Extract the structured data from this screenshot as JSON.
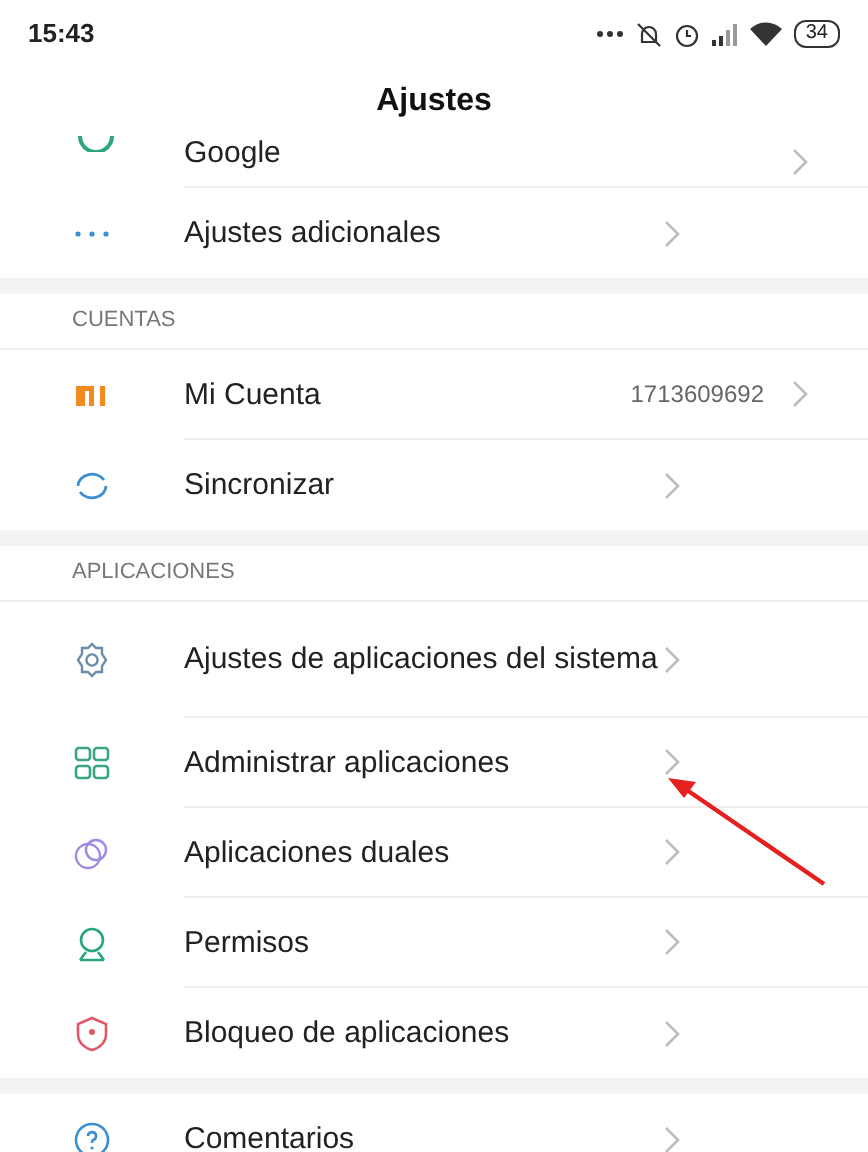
{
  "status_bar": {
    "time": "15:43",
    "battery": "34"
  },
  "title": "Ajustes",
  "sections": [
    {
      "items": [
        {
          "label": "Google"
        },
        {
          "label": "Ajustes adicionales"
        }
      ]
    },
    {
      "header": "CUENTAS",
      "items": [
        {
          "label": "Mi Cuenta",
          "value": "1713609692"
        },
        {
          "label": "Sincronizar"
        }
      ]
    },
    {
      "header": "APLICACIONES",
      "items": [
        {
          "label": "Ajustes de aplicaciones del sistema"
        },
        {
          "label": "Administrar aplicaciones"
        },
        {
          "label": "Aplicaciones duales"
        },
        {
          "label": "Permisos"
        },
        {
          "label": "Bloqueo de aplicaciones"
        }
      ]
    },
    {
      "items": [
        {
          "label": "Comentarios"
        }
      ]
    }
  ]
}
